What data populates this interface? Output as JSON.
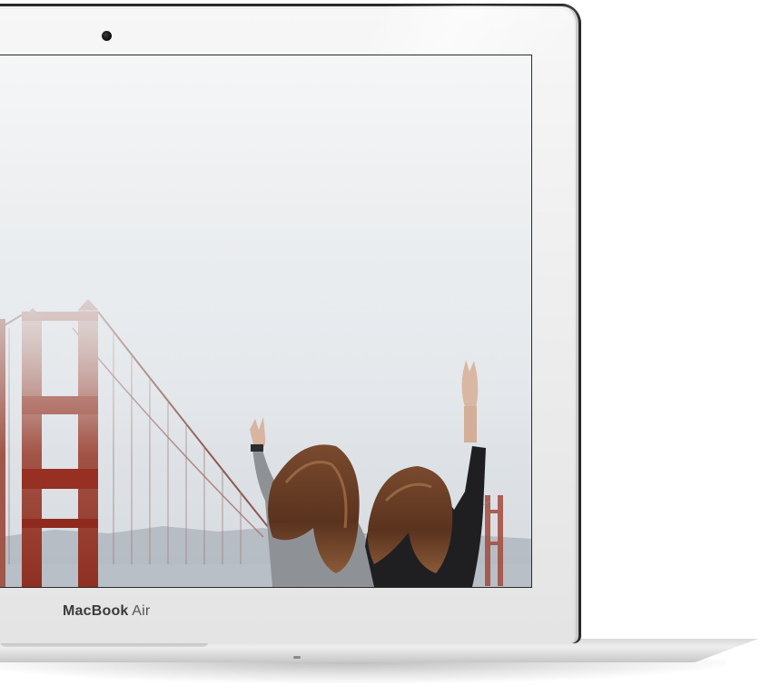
{
  "device": {
    "brand_bold": "MacBook",
    "brand_light": "Air"
  },
  "screen": {
    "image_subject": "two-women-peace-signs-golden-gate-bridge-fog"
  },
  "colors": {
    "bridge": "#9c3a2c",
    "sky": "#e9ebee",
    "bezel": "#efefef"
  }
}
